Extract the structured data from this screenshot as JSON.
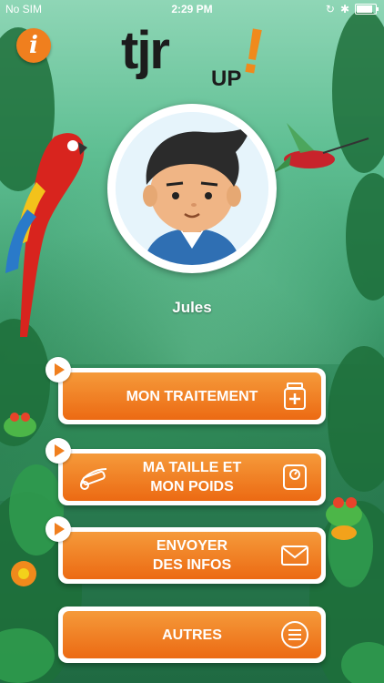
{
  "status_bar": {
    "carrier": "No SIM",
    "time": "2:29 PM"
  },
  "header": {
    "info_glyph": "i",
    "logo_main": "tjr",
    "logo_up": "UP",
    "logo_bang": "!"
  },
  "profile": {
    "name": "Jules"
  },
  "menu": {
    "items": [
      {
        "label": "MON TRAITEMENT",
        "icon": "medicine-icon"
      },
      {
        "label": "MA TAILLE ET\nMON POIDS",
        "icon": "scale-icon"
      },
      {
        "label": "ENVOYER\nDES INFOS",
        "icon": "envelope-icon"
      },
      {
        "label": "AUTRES",
        "icon": "menu-icon"
      }
    ]
  },
  "colors": {
    "accent": "#ec6a13",
    "background": "#3e9d6e"
  }
}
